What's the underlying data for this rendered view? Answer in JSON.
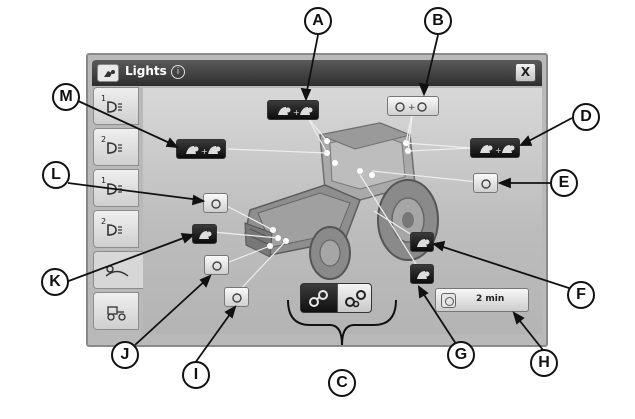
{
  "window": {
    "title": "Lights",
    "info_glyph": "i",
    "close_label": "X"
  },
  "side_tabs": [
    {
      "name": "tab-lights-1",
      "number": "1",
      "icon": "work-light-icon"
    },
    {
      "name": "tab-lights-2",
      "number": "2",
      "icon": "work-light-icon"
    },
    {
      "name": "tab-lights-3",
      "number": "1",
      "icon": "work-light-icon"
    },
    {
      "name": "tab-lights-4",
      "number": "2",
      "icon": "work-light-icon"
    },
    {
      "name": "tab-lights-5",
      "number": "",
      "icon": "field-light-icon",
      "active": true
    },
    {
      "name": "tab-lights-6",
      "number": "",
      "icon": "tractor-light-icon"
    }
  ],
  "timer": {
    "label": "2 min"
  },
  "callouts": [
    "A",
    "B",
    "C",
    "D",
    "E",
    "F",
    "G",
    "H",
    "I",
    "J",
    "K",
    "L",
    "M"
  ],
  "colors": {
    "bezel": "#b9b9b9",
    "titlebar": "#3a3a3a",
    "active_button": "#111111",
    "inactive_button": "#e6e6e6"
  }
}
